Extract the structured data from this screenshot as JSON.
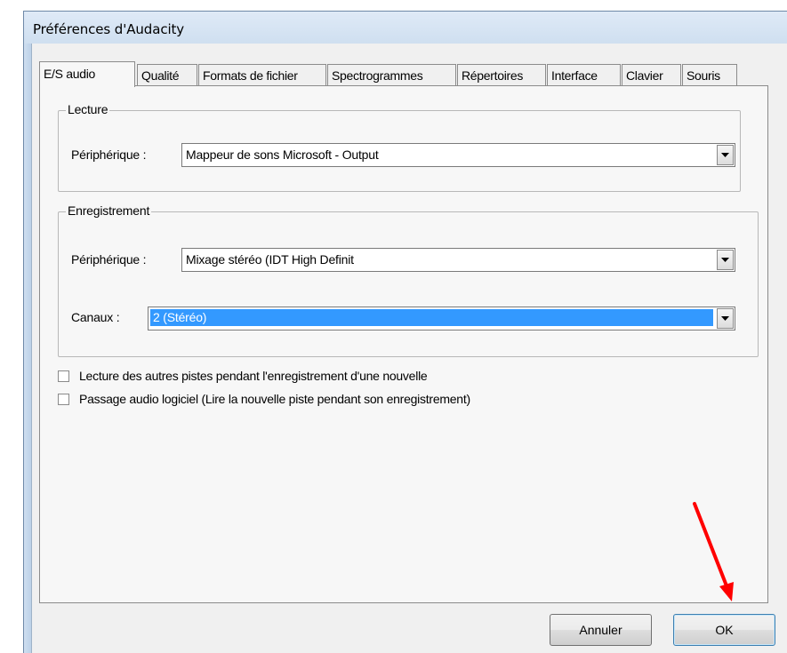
{
  "window": {
    "title": "Préférences d'Audacity"
  },
  "tabs": [
    {
      "label": "E/S audio",
      "active": true
    },
    {
      "label": "Qualité",
      "active": false
    },
    {
      "label": "Formats de fichier",
      "active": false
    },
    {
      "label": "Spectrogrammes",
      "active": false
    },
    {
      "label": "Répertoires",
      "active": false
    },
    {
      "label": "Interface",
      "active": false
    },
    {
      "label": "Clavier",
      "active": false
    },
    {
      "label": "Souris",
      "active": false
    }
  ],
  "playback": {
    "group_label": "Lecture",
    "device_label": "Périphérique :",
    "device_value": "Mappeur de sons Microsoft - Output"
  },
  "recording": {
    "group_label": "Enregistrement",
    "device_label": "Périphérique :",
    "device_value": "Mixage stéréo (IDT High Definit",
    "channels_label": "Canaux :",
    "channels_value": "2 (Stéréo)"
  },
  "options": [
    {
      "label": "Lecture des autres pistes pendant l'enregistrement d'une nouvelle",
      "checked": false
    },
    {
      "label": "Passage audio logiciel (Lire la nouvelle piste pendant son enregistrement)",
      "checked": false
    }
  ],
  "buttons": {
    "cancel_label": "Annuler",
    "ok_label": "OK"
  },
  "annotation": {
    "arrow_color": "#ff0000",
    "arrow_target": "ok-button"
  },
  "colors": {
    "selection": "#3399ff",
    "frame": "#d7e4f2"
  }
}
